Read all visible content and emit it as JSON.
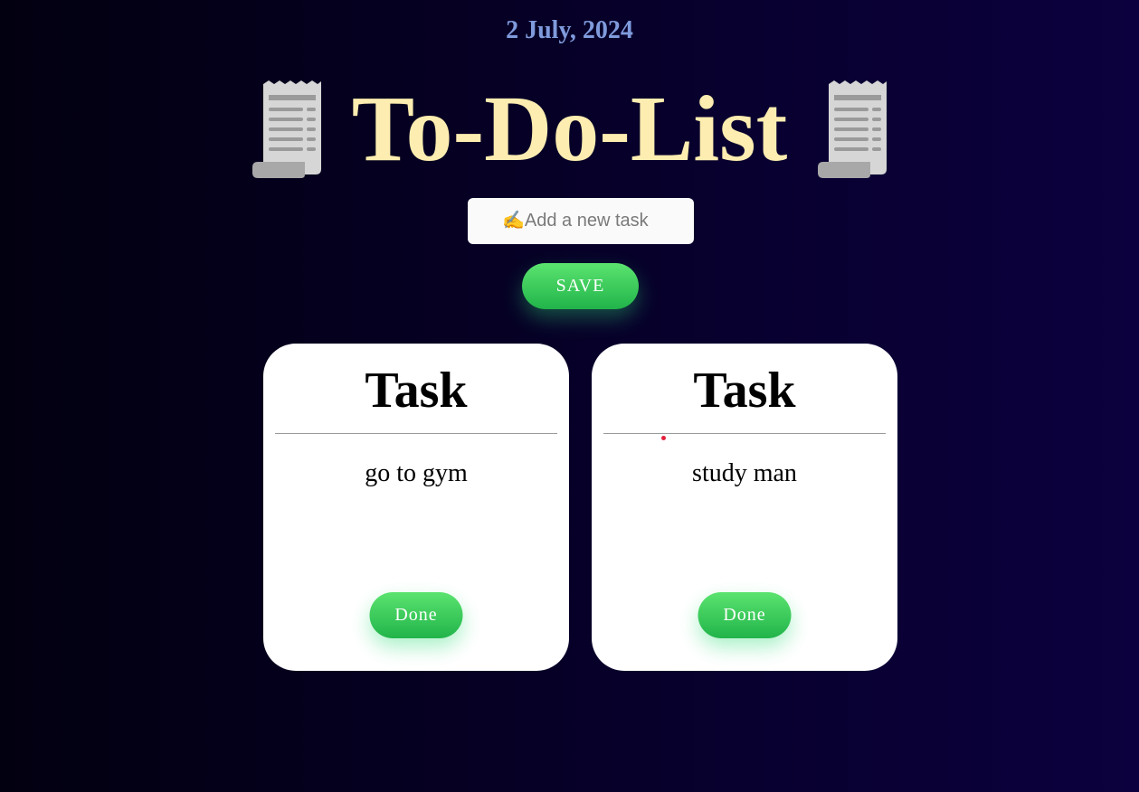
{
  "header": {
    "date": "2 July, 2024",
    "title": "To-Do-List",
    "left_icon": "receipt-icon",
    "right_icon": "receipt-icon"
  },
  "form": {
    "input_placeholder": "✍️Add a new task",
    "input_value": "",
    "save_label": "SAVE"
  },
  "tasks": [
    {
      "heading": "Task",
      "text": "go to gym",
      "done_label": "Done"
    },
    {
      "heading": "Task",
      "text": "study man",
      "done_label": "Done"
    }
  ],
  "colors": {
    "background": "#07002a",
    "date": "#7f9bdc",
    "title": "#fdedb0",
    "button": "#2ec657",
    "card": "#ffffff"
  }
}
